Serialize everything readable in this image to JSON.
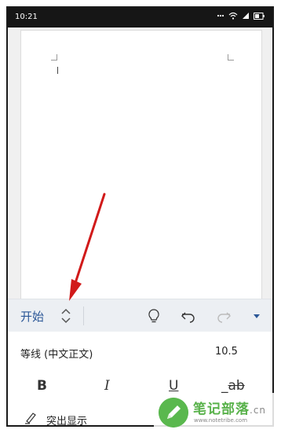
{
  "status_bar": {
    "time": "10:21"
  },
  "ribbon": {
    "tab_label": "开始",
    "icons": [
      "tab-switch-chevrons-icon",
      "lightbulb-icon",
      "undo-icon",
      "redo-icon",
      "dropdown-triangle-icon"
    ]
  },
  "font": {
    "name": "等线 (中文正文)",
    "size": "10.5"
  },
  "format": {
    "bold": "B",
    "italic": "I",
    "underline": "U",
    "strike_prefix": "_",
    "strike_text": "ab"
  },
  "highlight": {
    "label": "突出显示"
  },
  "watermark": {
    "title": "笔记部落",
    "suffix": ".cn",
    "url": "www.notetribe.com"
  },
  "colors": {
    "accent": "#2b5797",
    "annotation_arrow": "#d11a1a",
    "watermark_green": "#5ab84e"
  }
}
